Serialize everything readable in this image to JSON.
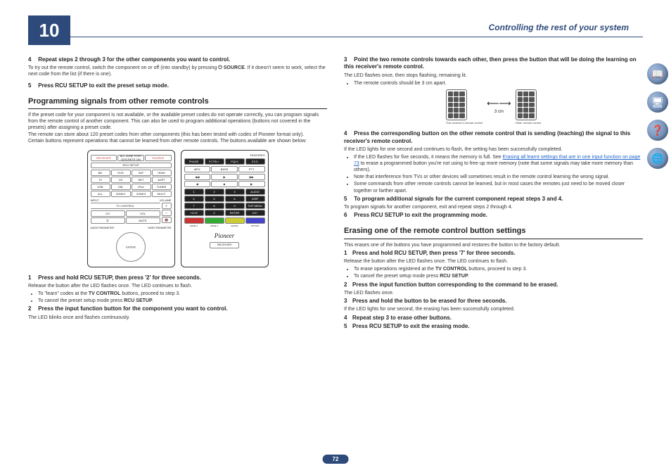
{
  "chapter": {
    "number": "10",
    "title": "Controlling the rest of your system"
  },
  "pageNumber": "72",
  "nav": {
    "icons": [
      "book-icon",
      "computer-icon",
      "help-icon",
      "globe-icon"
    ]
  },
  "left": {
    "step4": {
      "n": "4",
      "title": "Repeat steps 2 through 3 for the other components you want to control.",
      "body": "To try out the remote control, switch the component on or off (into standby) by pressing ",
      "source": "SOURCE",
      "body2": ". If it doesn't seem to work, select the next code from the list (if there is one)."
    },
    "step5": {
      "n": "5",
      "title": "Press RCU SETUP to exit the preset setup mode."
    },
    "h_prog": "Programming signals from other remote controls",
    "prog_p1": "If the preset code for your component is not available, or the available preset codes do not operate correctly, you can program signals from the remote control of another component. This can also be used to program additional operations (buttons not covered in the presets) after assigning a preset code.",
    "prog_p2": "The remote can store about 120 preset codes from other components (this has been tested with codes of Pioneer format only).",
    "prog_p3": "Certain buttons represent operations that cannot be learned from other remote controls. The buttons available are shown below:",
    "remoteA": {
      "topRow": [
        "RECEIVER",
        "ALL ZONE STBY DISCRETE ON",
        "SOURCE"
      ],
      "row2": [
        "BD",
        "DVD",
        "SAT",
        "HDMI"
      ],
      "row3": [
        "TV",
        "CD",
        "NET",
        "ADPT"
      ],
      "row4": [
        "USB",
        "CBL",
        "iPod",
        "TUNER"
      ],
      "row5": [
        "ALL",
        "ZONE2",
        "ZONE3",
        "MULTI"
      ],
      "inputLabel": "INPUT",
      "volLabel": "VOLUME",
      "tvctrl": "TV CONTROL",
      "tvbtns": [
        "CH",
        "VOL",
        "MUTE"
      ],
      "bottom": [
        "AUDIO PARAMETER",
        "",
        "VIDEO PARAMETER"
      ],
      "rcu": "RCU SETUP"
    },
    "remoteB": {
      "features": "FEATURES",
      "row1": [
        "PHASE",
        "FCTRL+",
        "PQLS",
        "ECO"
      ],
      "row2": [
        "MPX",
        "BASS",
        "PTY"
      ],
      "transport": [
        "◀◀",
        "▶",
        "▶▶"
      ],
      "transport2": [
        "◀",
        "■",
        "▶"
      ],
      "num": [
        [
          "1",
          "2",
          "3",
          "AUDIO"
        ],
        [
          "+",
          "4",
          "5",
          "6",
          "DISP"
        ],
        [
          "7",
          "8",
          "9",
          "TOP MENU"
        ],
        [
          "+CLR",
          "0",
          "ENTER",
          "CH+"
        ]
      ],
      "colors": [
        "ZONE 2",
        "ZONE 3",
        "Z2/Z3S",
        "OPTION"
      ],
      "brand": "Pioneer",
      "receiver": "RECEIVER"
    },
    "progStep1": {
      "n": "1",
      "title": "Press and hold RCU SETUP, then press '2' for three seconds.",
      "body": "Release the button after the LED flashes once. The LED continues to flash.",
      "bul1a": "To \"learn\" codes at the ",
      "bul1b": "TV CONTROL",
      "bul1c": " buttons, proceed to step 3.",
      "bul2a": "To cancel the preset setup mode press ",
      "bul2b": "RCU SETUP",
      "bul2c": "."
    },
    "progStep2": {
      "n": "2",
      "title": "Press the input function button for the component you want to control.",
      "body": "The LED blinks once and flashes continuously."
    }
  },
  "right": {
    "step3": {
      "n": "3",
      "title": "Point the two remote controls towards each other, then press the button that will be doing the learning on this receiver's remote control.",
      "body": "The LED flashes once, then stops flashing, remaining lit.",
      "bul": "The remote controls should be 3 cm apart."
    },
    "diagram": {
      "left": "This receiver's remote control",
      "dist": "3 cm",
      "right": "Other remote control"
    },
    "step4": {
      "n": "4",
      "title": "Press the corresponding button on the other remote control that is sending (teaching) the signal to this receiver's remote control.",
      "body": "If the LED lights for one second and continues to flash, the setting has been successfully completed.",
      "bul1a": "If the LED flashes for five seconds, it means the memory is full. See ",
      "linkText": "Erasing all learnt settings that are in one input function",
      "linkPage": " on page 73",
      "bul1b": " to erase a programmed button you're not using to free up more memory (note that some signals may take more memory than others).",
      "bul2": "Note that interference from TVs or other devices will sometimes result in the remote control learning the wrong signal.",
      "bul3": "Some commands from other remote controls cannot be learned, but in most cases the remotes just need to be moved closer together or farther apart."
    },
    "step5": {
      "n": "5",
      "title": "To program additional signals for the current component repeat steps 3 and 4.",
      "body": "To program signals for another component, exit and repeat steps 2 through 4."
    },
    "step6": {
      "n": "6",
      "title": "Press RCU SETUP to exit the programming mode."
    },
    "h_erase": "Erasing one of the remote control button settings",
    "erase_p": "This erases one of the buttons you have programmed and restores the button to the factory default.",
    "eStep1": {
      "n": "1",
      "title": "Press and hold RCU SETUP, then press '7' for three seconds.",
      "body": "Release the button after the LED flashes once. The LED continues to flash.",
      "bul1a": "To erase operations registered at the ",
      "bul1b": "TV CONTROL",
      "bul1c": " buttons, proceed to step 3.",
      "bul2a": "To cancel the preset setup mode press ",
      "bul2b": "RCU SETUP",
      "bul2c": "."
    },
    "eStep2": {
      "n": "2",
      "title": "Press the input function button corresponding to the command to be erased.",
      "body": "The LED flashes once."
    },
    "eStep3": {
      "n": "3",
      "title": "Press and hold the button to be erased for three seconds.",
      "body": "If the LED lights for one second, the erasing has been successfully completed."
    },
    "eStep4": {
      "n": "4",
      "title": "Repeat step 3 to erase other buttons."
    },
    "eStep5": {
      "n": "5",
      "title": "Press RCU SETUP to exit the erasing mode."
    }
  }
}
